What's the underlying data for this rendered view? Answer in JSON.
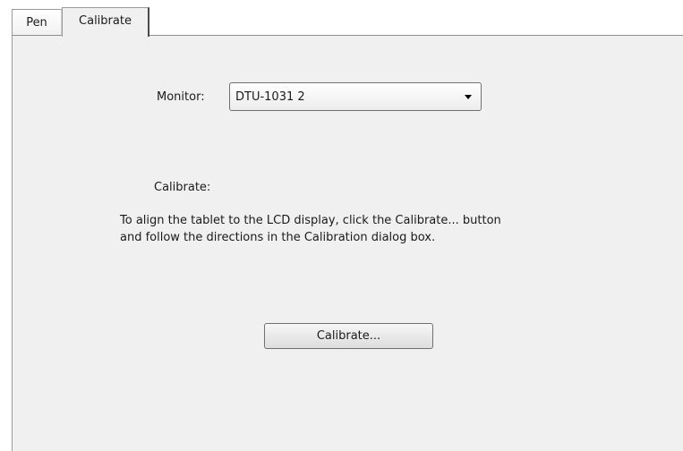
{
  "tabs": {
    "pen_label": "Pen",
    "calibrate_label": "Calibrate",
    "selected": "Calibrate"
  },
  "monitor": {
    "label": "Monitor:",
    "selected_value": "DTU-1031 2"
  },
  "calibrate_section": {
    "heading": "Calibrate:",
    "instruction_line_1": "To align the tablet to the LCD display, click the Calibrate... button",
    "instruction_line_2": "and follow the directions in the Calibration dialog box.",
    "button_label": "Calibrate..."
  }
}
